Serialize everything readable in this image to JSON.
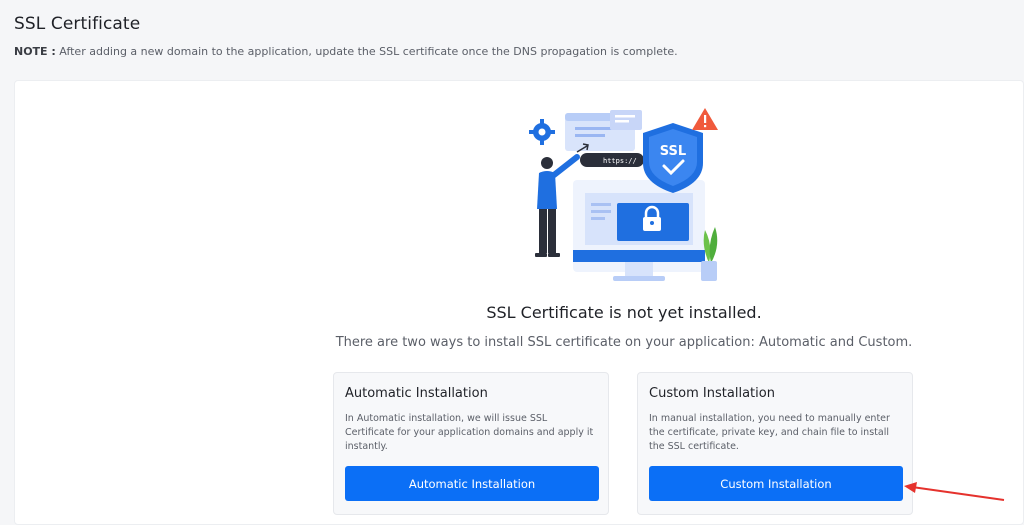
{
  "header": {
    "title": "SSL Certificate",
    "note_label": "NOTE :",
    "note_text": " After adding a new domain to the application, update the SSL certificate once the DNS propagation is complete."
  },
  "status": {
    "headline": "SSL Certificate is not yet installed.",
    "subline": "There are two ways to install SSL certificate on your application: Automatic and Custom."
  },
  "illustration": {
    "url_text": "https://",
    "shield_text": "SSL"
  },
  "options": [
    {
      "title": "Automatic Installation",
      "description": "In Automatic installation, we will issue SSL Certificate for your application domains and apply it instantly.",
      "button_label": "Automatic Installation"
    },
    {
      "title": "Custom Installation",
      "description": "In manual installation, you need to manually enter the certificate, private key, and chain file to install the SSL certificate.",
      "button_label": "Custom Installation"
    }
  ],
  "colors": {
    "primary": "#0b6ff6",
    "annotation_arrow": "#e5322d",
    "warning": "#f05a3c"
  }
}
